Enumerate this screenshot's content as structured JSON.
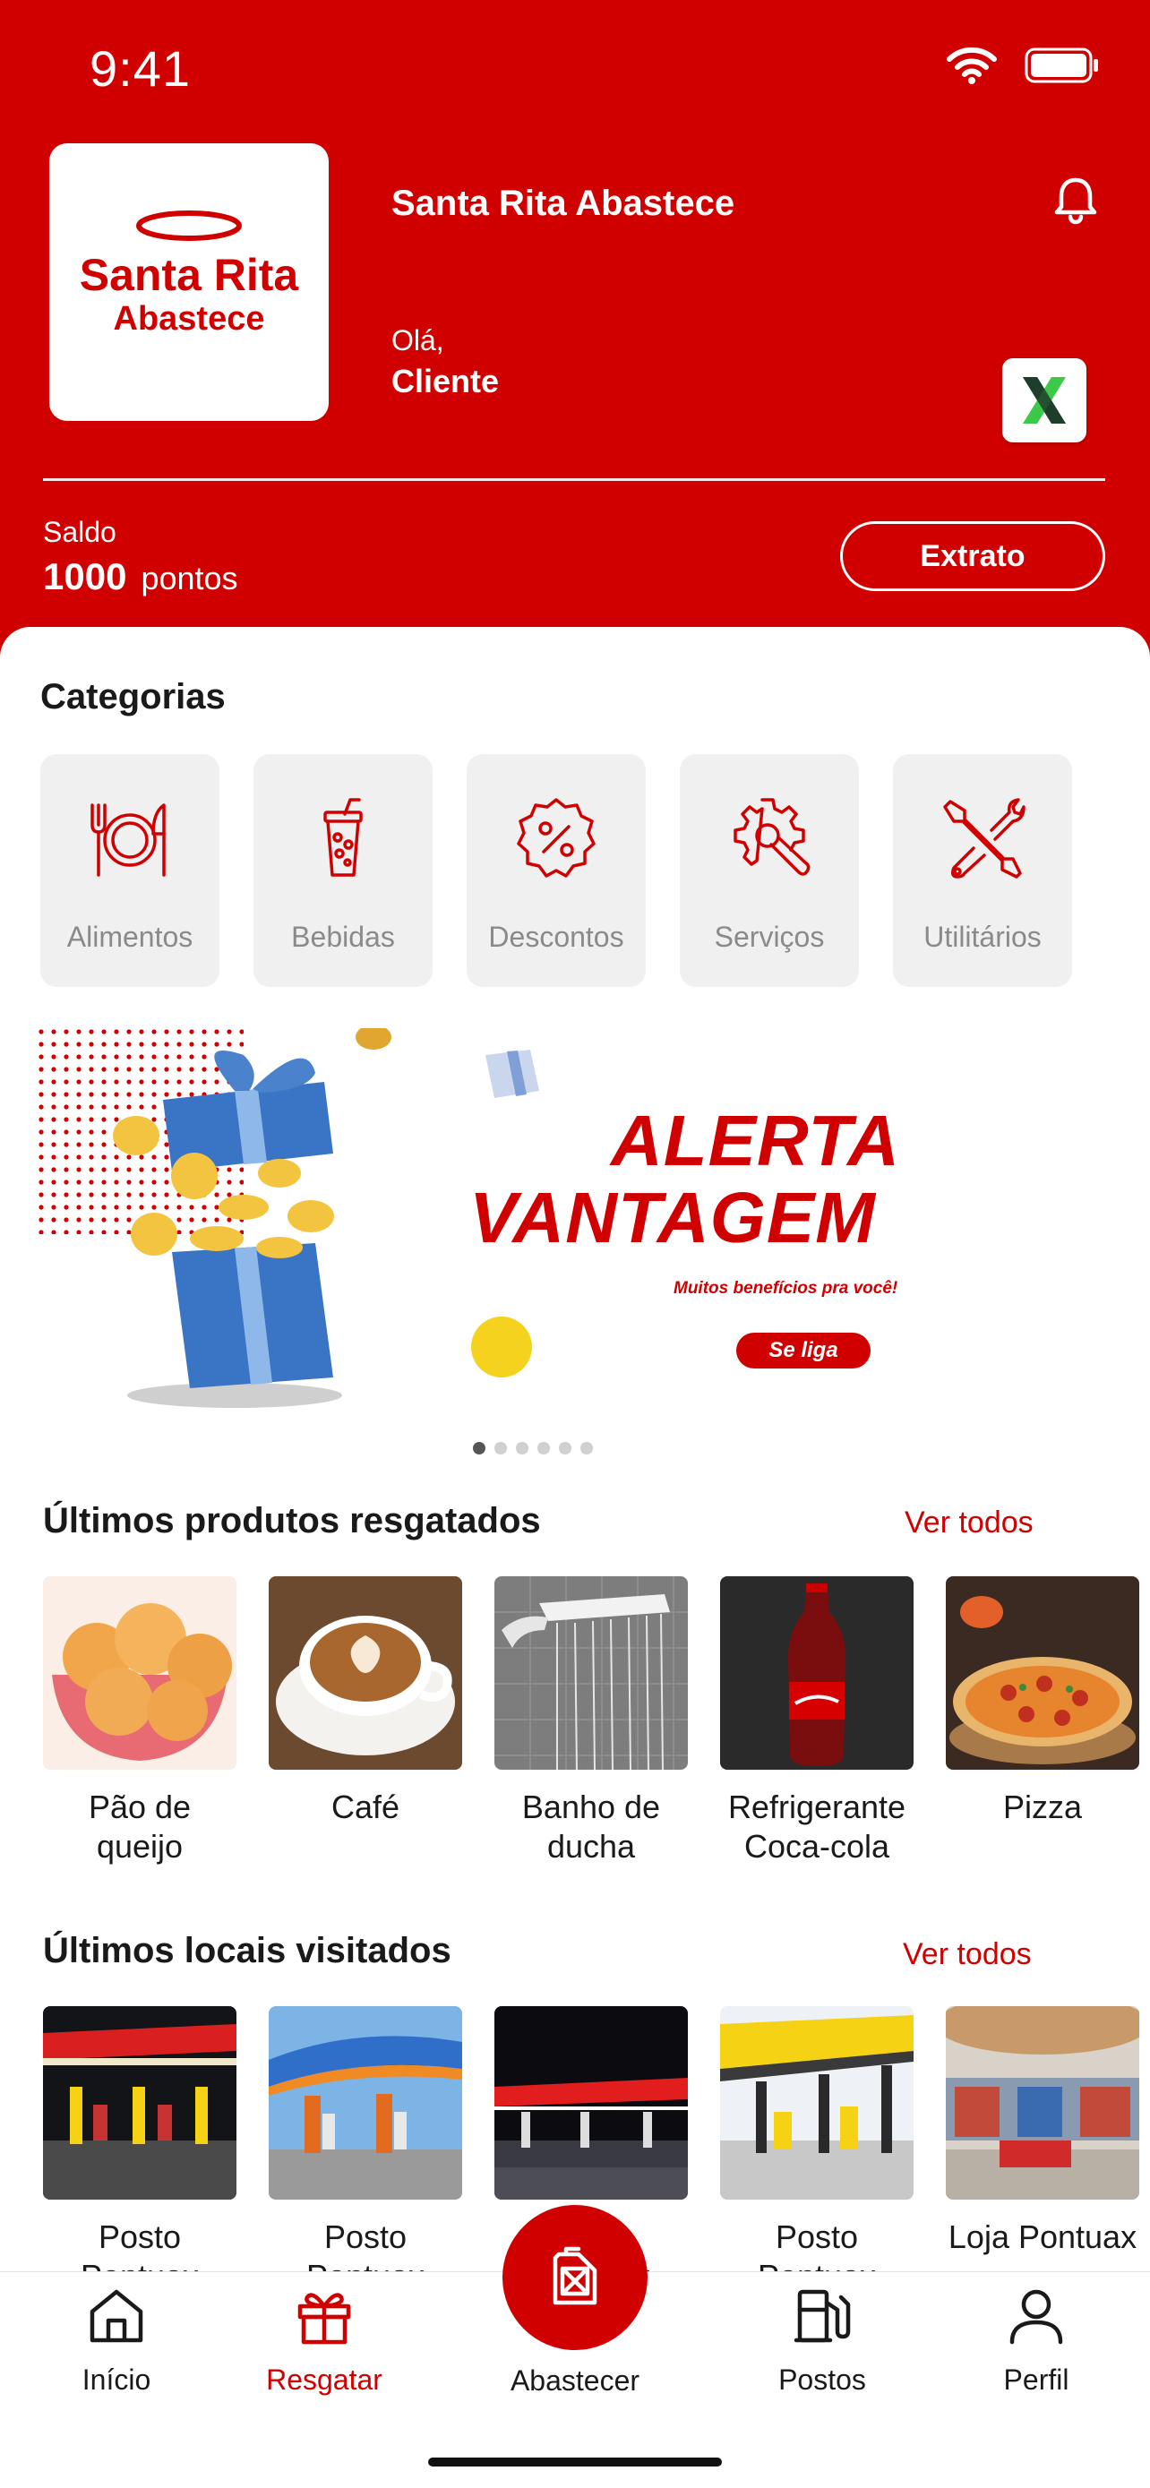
{
  "status_bar": {
    "time": "9:41"
  },
  "header": {
    "logo_line1": "Santa Rita",
    "logo_line2": "Abastece",
    "app_name": "Santa Rita Abastece",
    "greeting": "Olá,",
    "user_name": "Cliente",
    "balance_label": "Saldo",
    "balance_value": "1000",
    "balance_unit": "pontos",
    "statement_button": "Extrato"
  },
  "categories": {
    "title": "Categorias",
    "items": [
      {
        "label": "Alimentos",
        "icon": "utensils-icon"
      },
      {
        "label": "Bebidas",
        "icon": "drink-cup-icon"
      },
      {
        "label": "Descontos",
        "icon": "percent-badge-icon"
      },
      {
        "label": "Serviços",
        "icon": "gear-wrench-icon"
      },
      {
        "label": "Utilitários",
        "icon": "tools-icon"
      }
    ]
  },
  "banner": {
    "title_line1": "ALERTA",
    "title_line2": "VANTAGEM",
    "subtitle": "Muitos benefícios pra você!",
    "cta": "Se liga",
    "pages": 6,
    "active_page": 1
  },
  "products": {
    "title": "Últimos produtos resgatados",
    "see_all": "Ver todos",
    "items": [
      {
        "label": "Pão de queijo"
      },
      {
        "label": "Café"
      },
      {
        "label": "Banho de ducha"
      },
      {
        "label": "Refrigerante Coca-cola"
      },
      {
        "label": "Pizza"
      }
    ]
  },
  "places": {
    "title": "Últimos locais visitados",
    "see_all": "Ver todos",
    "items": [
      {
        "label": "Posto Pontuax"
      },
      {
        "label": "Posto Pontuax"
      },
      {
        "label": "Posto Pontuax"
      },
      {
        "label": "Posto Pontuax"
      },
      {
        "label": "Loja Pontuax"
      }
    ]
  },
  "tabbar": {
    "items": [
      {
        "label": "Início",
        "icon": "home-icon"
      },
      {
        "label": "Resgatar",
        "icon": "gift-icon",
        "active": true
      },
      {
        "label": "Abastecer",
        "icon": "fuel-can-icon"
      },
      {
        "label": "Postos",
        "icon": "fuel-pump-icon"
      },
      {
        "label": "Perfil",
        "icon": "user-icon"
      }
    ]
  },
  "colors": {
    "brand_red": "#d10000",
    "tile_gray": "#f0f0f0",
    "muted_text": "#8a8a8a"
  }
}
